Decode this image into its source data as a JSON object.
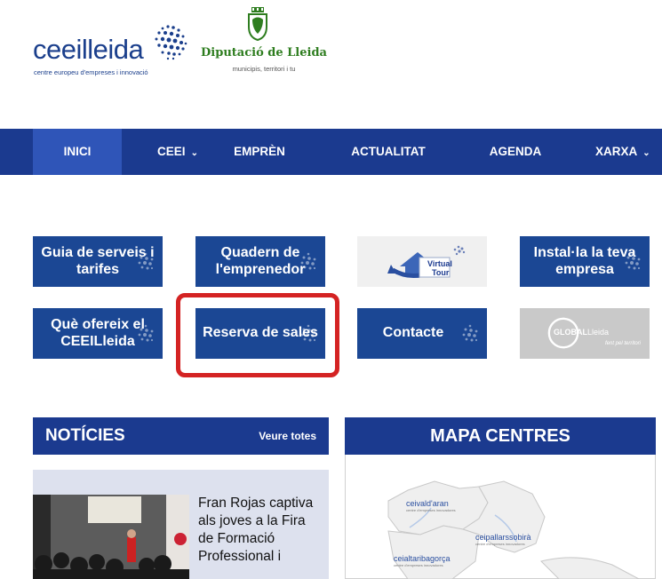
{
  "header": {
    "ceei_logo": {
      "word": "ceeilleida",
      "tagline": "centre europeu d'empreses i innovació"
    },
    "diputacio_logo": {
      "name": "Diputació de Lleida",
      "tagline": "municipis, territori i tu"
    }
  },
  "nav": {
    "items": [
      {
        "label": "INICI",
        "active": true
      },
      {
        "label": "CEEI",
        "chevron": "⌄"
      },
      {
        "label": "EMPRÈN"
      },
      {
        "label": "ACTUALITAT"
      },
      {
        "label": "AGENDA"
      },
      {
        "label": "XARXA",
        "chevron": "⌄"
      }
    ]
  },
  "tiles": {
    "guia": "Guia de serveis i tarifes",
    "quadern": "Quadern de l'emprenedor",
    "virtual_tour": {
      "line1": "Virtual",
      "line2": "Tour"
    },
    "installa": "Instal·la la teva empresa",
    "que_ofereix": "Què ofereix el CEEILleida",
    "reserva": "Reserva de sales",
    "contacte": "Contacte",
    "global_lleida": {
      "brand": "GLOBAL",
      "brand2": "Lleida",
      "tagline": "fent pel territori"
    }
  },
  "noticies": {
    "title": "NOTÍCIES",
    "link": "Veure totes",
    "headline": "Fran Rojas captiva als joves a la Fira de Formació Professional i"
  },
  "mapa": {
    "title": "MAPA CENTRES",
    "labels": [
      {
        "name": "ceivald'aran",
        "sub": "centre d'empreses innovadores"
      },
      {
        "name": "ceipallarssobirà",
        "sub": "centre d'empreses innovadores"
      },
      {
        "name": "ceialtaribagorça",
        "sub": "centre d'empreses innovadores"
      }
    ]
  },
  "colors": {
    "primary": "#1b3a8f",
    "tile": "#1b4794",
    "active": "#2f55b8",
    "highlight": "#d42323",
    "dip_green": "#2e7d1f"
  }
}
